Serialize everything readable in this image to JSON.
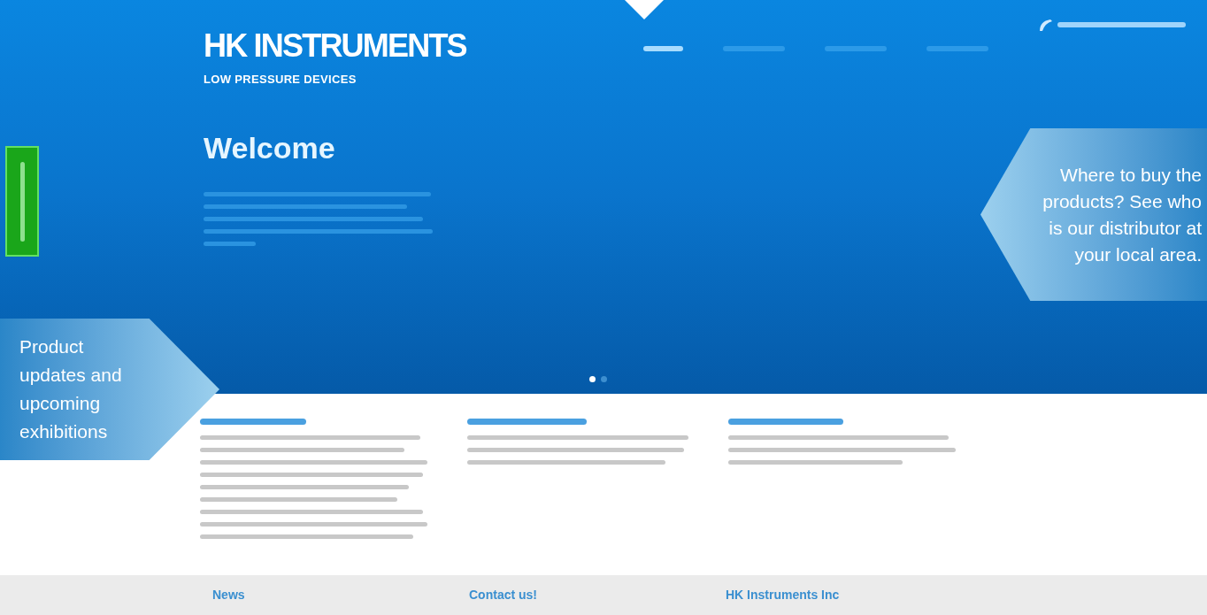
{
  "header": {
    "logo": "HK INSTRUMENTS",
    "tagline": "LOW PRESSURE DEVICES"
  },
  "hero": {
    "title": "Welcome"
  },
  "nav": [
    {
      "selected": true
    },
    {
      "selected": false
    },
    {
      "selected": false
    },
    {
      "selected": false
    }
  ],
  "slider_dots": [
    {
      "selected": true
    },
    {
      "selected": false
    }
  ],
  "callouts": [
    {
      "kind": "right",
      "text": "Where to buy the products? See who is our distributor at your local area."
    },
    {
      "kind": "left",
      "text": "Product updates and upcoming exhibitions"
    }
  ],
  "footer": {
    "headings": [
      "News",
      "Contact us!",
      "HK Instruments Inc"
    ]
  }
}
